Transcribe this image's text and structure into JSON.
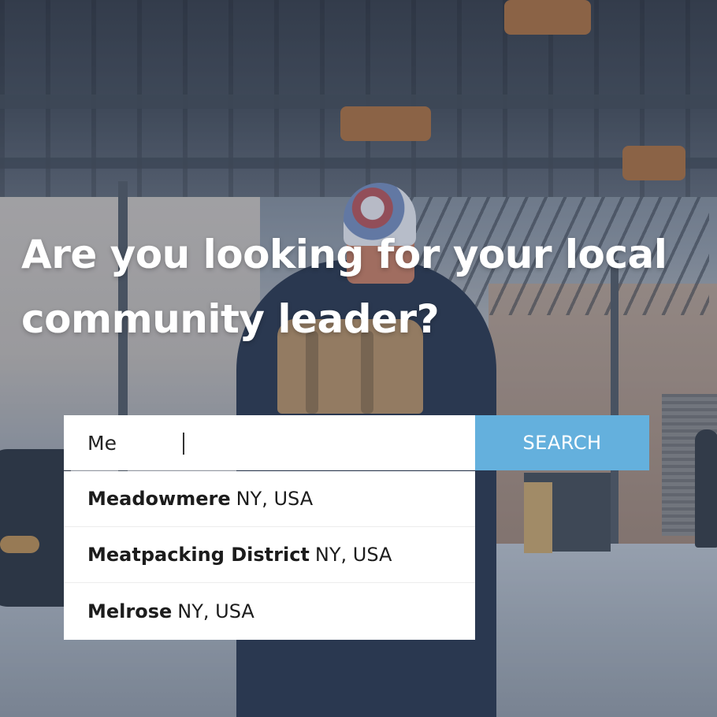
{
  "hero": {
    "headline_line1": "Are you looking for your local",
    "headline_line2": "community leader?"
  },
  "search": {
    "value": "Me",
    "button_label": "SEARCH"
  },
  "suggestions": [
    {
      "name": "Meadowmere",
      "region": "NY, USA"
    },
    {
      "name": "Meatpacking District",
      "region": "NY, USA"
    },
    {
      "name": "Melrose",
      "region": "NY, USA"
    }
  ],
  "colors": {
    "button_bg": "#64b0dd",
    "headline_text": "#ffffff",
    "dropdown_bg": "#ffffff"
  }
}
